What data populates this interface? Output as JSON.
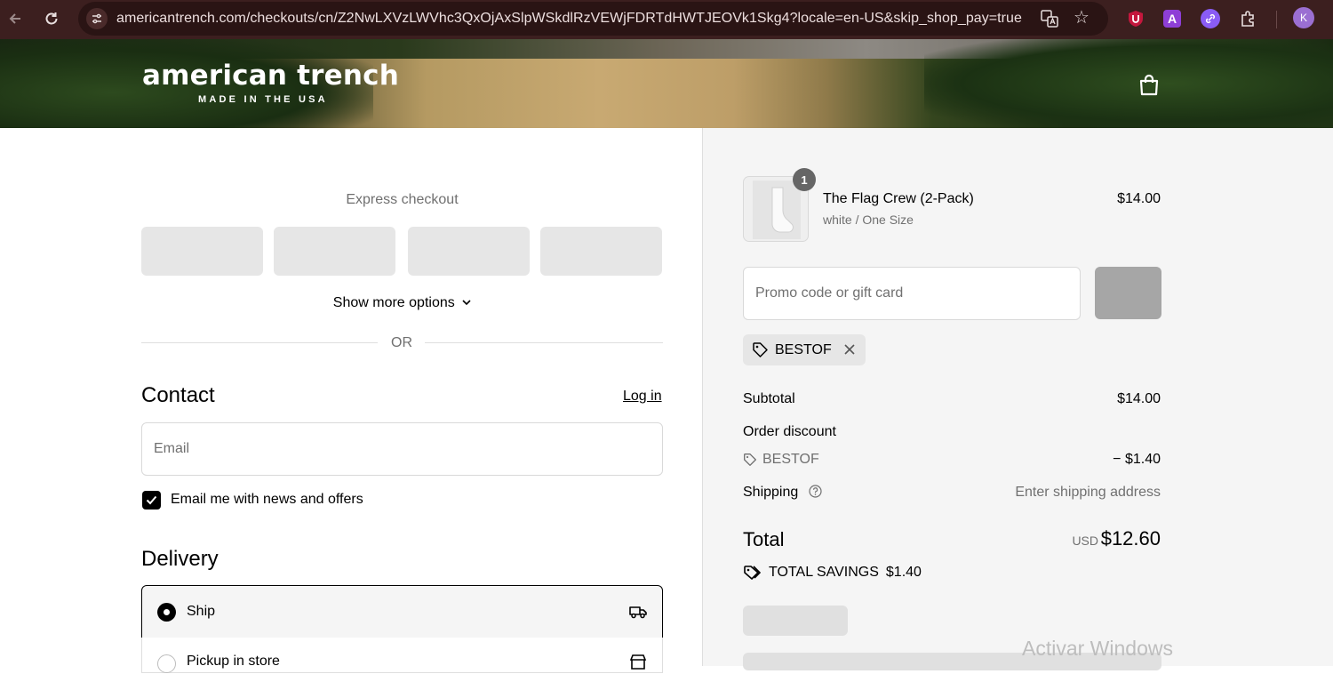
{
  "browser": {
    "url": "americantrench.com/checkouts/cn/Z2NwLXVzLWVhc3QxOjAxSlpWSkdlRzVEWjFDRTdHWTJEOVk1Skg4?locale=en-US&skip_shop_pay=true",
    "profile_initial": "K",
    "extension_a_label": "A"
  },
  "header": {
    "logo_main": "american trench",
    "logo_tagline": "MADE IN THE USA",
    "cart_icon": "shopping-bag-icon"
  },
  "express_checkout": {
    "title": "Express checkout",
    "show_more_label": "Show more options",
    "divider_label": "OR"
  },
  "contact": {
    "heading": "Contact",
    "login_label": "Log in",
    "email_placeholder": "Email",
    "email_value": "",
    "news_opt_in_label": "Email me with news and offers",
    "news_opt_in_checked": true
  },
  "delivery": {
    "heading": "Delivery",
    "options": [
      {
        "label": "Ship",
        "selected": true,
        "icon": "truck-icon"
      },
      {
        "label": "Pickup in store",
        "selected": false,
        "icon": "store-icon"
      }
    ]
  },
  "order_summary": {
    "item": {
      "quantity": "1",
      "name": "The Flag Crew (2-Pack)",
      "variant": "white / One Size",
      "price": "$14.00"
    },
    "promo_placeholder": "Promo code or gift card",
    "applied_code": "BESTOF",
    "subtotal_label": "Subtotal",
    "subtotal_value": "$14.00",
    "discount_label": "Order discount",
    "discount_code": "BESTOF",
    "discount_value": "− $1.40",
    "shipping_label": "Shipping",
    "shipping_value": "Enter shipping address",
    "total_label": "Total",
    "total_currency": "USD",
    "total_value": "$12.60",
    "savings_label": "TOTAL SAVINGS",
    "savings_value": "$1.40"
  },
  "os_watermark": "Activar Windows",
  "colors": {
    "chrome_bg": "#3c1f1f",
    "summary_bg": "#f5f5f5",
    "checkbox_fill": "#000000",
    "muted_text": "#707070"
  }
}
